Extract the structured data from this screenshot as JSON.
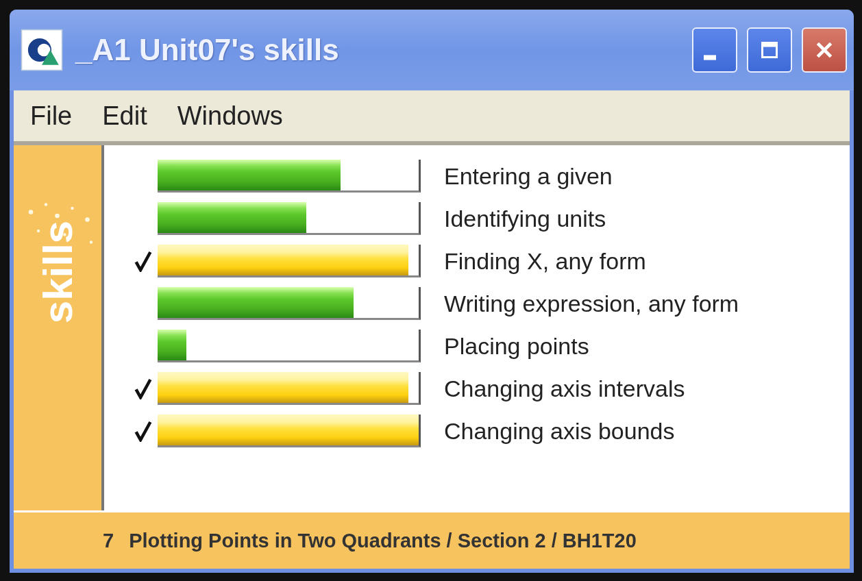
{
  "window": {
    "title": "_A1 Unit07's skills"
  },
  "menu": [
    "File",
    "Edit",
    "Windows"
  ],
  "sidebar": {
    "label": "skills"
  },
  "skills": [
    {
      "name": "Entering a given",
      "level": 0.7,
      "checked": false
    },
    {
      "name": "Identifying units",
      "level": 0.57,
      "checked": false
    },
    {
      "name": "Finding X, any form",
      "level": 0.96,
      "checked": true
    },
    {
      "name": "Writing expression, any form",
      "level": 0.75,
      "checked": false
    },
    {
      "name": "Placing points",
      "level": 0.11,
      "checked": false
    },
    {
      "name": "Changing axis intervals",
      "level": 0.96,
      "checked": true
    },
    {
      "name": "Changing axis bounds",
      "level": 1.0,
      "checked": true
    }
  ],
  "status_bar": {
    "number": "7",
    "text": "Plotting Points in Two Quadrants / Section 2 / BH1T20"
  }
}
